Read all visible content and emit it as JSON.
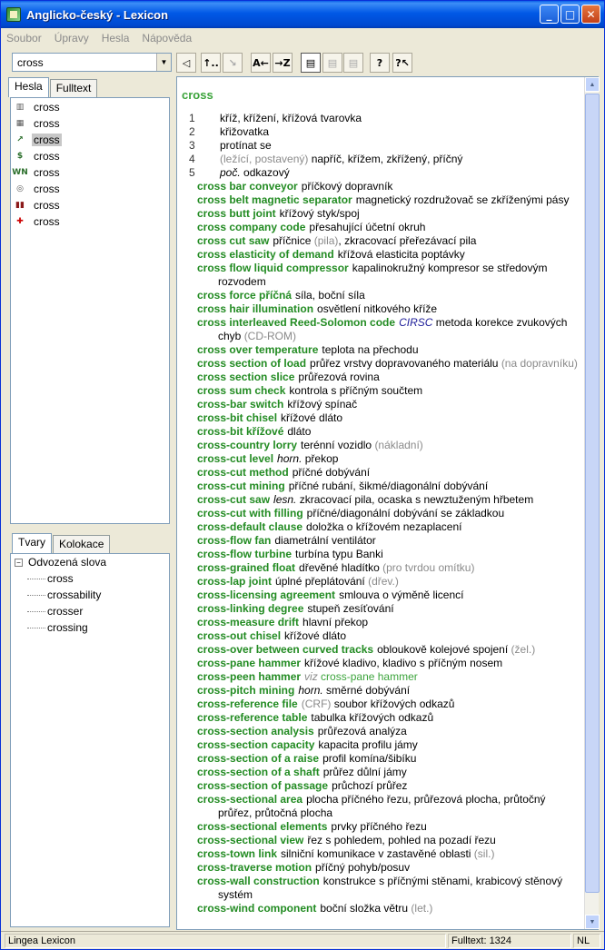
{
  "window": {
    "title": "Anglicko-český - Lexicon"
  },
  "menu": [
    "Soubor",
    "Úpravy",
    "Hesla",
    "Nápověda"
  ],
  "search": {
    "value": "cross"
  },
  "toolbar": {
    "tools": [
      {
        "name": "speaker-tool",
        "glyph": "◁"
      },
      {
        "name": "back-tool",
        "glyph": "↑.."
      },
      {
        "name": "forward-tool",
        "glyph": "↘",
        "disabled": true
      },
      {
        "name": "sort-az-tool",
        "glyph": "A←"
      },
      {
        "name": "sort-za-tool",
        "glyph": "→Z"
      },
      {
        "name": "view-full-tool",
        "glyph": "▤",
        "pressed": true
      },
      {
        "name": "view-medium-tool",
        "glyph": "▤",
        "disabled": true
      },
      {
        "name": "view-short-tool",
        "glyph": "▤",
        "disabled": true
      },
      {
        "name": "help-tool",
        "glyph": "?"
      },
      {
        "name": "context-help-tool",
        "glyph": "?↖"
      }
    ]
  },
  "left_tabs": [
    "Hesla",
    "Fulltext"
  ],
  "headwords": [
    {
      "label": "cross",
      "icon": "building-icon",
      "glyph": "▥",
      "color": "#555555"
    },
    {
      "label": "cross",
      "icon": "factory-icon",
      "glyph": "▦",
      "color": "#555555"
    },
    {
      "label": "cross",
      "icon": "chart-icon",
      "glyph": "↗",
      "color": "#2a6e2a",
      "selected": true
    },
    {
      "label": "cross",
      "icon": "money-icon",
      "glyph": "$",
      "color": "#2a6e2a"
    },
    {
      "label": "cross",
      "icon": "wn-icon",
      "glyph": "WN",
      "color": "#2a6e2a"
    },
    {
      "label": "cross",
      "icon": "handshake-icon",
      "glyph": "◎",
      "color": "#555555"
    },
    {
      "label": "cross",
      "icon": "books-icon",
      "glyph": "▮▮",
      "color": "#8b1a1a"
    },
    {
      "label": "cross",
      "icon": "medical-icon",
      "glyph": "✚",
      "color": "#cc0000"
    }
  ],
  "lower_tabs": [
    "Tvary",
    "Kolokace"
  ],
  "forms": {
    "root": "Odvozená slova",
    "items": [
      "cross",
      "crossability",
      "crosser",
      "crossing"
    ]
  },
  "entry": {
    "headword": "cross",
    "senses": [
      {
        "num": "1",
        "parts": [
          {
            "t": "kříž, křížení, křížová tvarovka"
          }
        ]
      },
      {
        "num": "2",
        "parts": [
          {
            "t": "křižovatka"
          }
        ]
      },
      {
        "num": "3",
        "parts": [
          {
            "t": "protínat se"
          }
        ]
      },
      {
        "num": "4",
        "parts": [
          {
            "t": "(ležící, postavený)",
            "c": "gray"
          },
          {
            "t": " napříč, křížem, zkřížený, příčný"
          }
        ]
      },
      {
        "num": "5",
        "parts": [
          {
            "t": "poč.",
            "c": "ital"
          },
          {
            "t": " odkazový"
          }
        ]
      }
    ],
    "phrases": [
      {
        "term": "cross bar conveyor",
        "parts": [
          {
            "t": "příčkový dopravník"
          }
        ]
      },
      {
        "term": "cross belt magnetic separator",
        "parts": [
          {
            "t": "magnetický rozdružovač se zkříženými pásy"
          }
        ]
      },
      {
        "term": "cross butt joint",
        "parts": [
          {
            "t": "křížový styk/spoj"
          }
        ]
      },
      {
        "term": "cross company code",
        "parts": [
          {
            "t": "přesahující účetní okruh"
          }
        ]
      },
      {
        "term": "cross cut saw",
        "parts": [
          {
            "t": "příčnice "
          },
          {
            "t": "(pila)",
            "c": "note"
          },
          {
            "t": ", zkracovací přeřezávací pila"
          }
        ]
      },
      {
        "term": "cross elasticity of demand",
        "parts": [
          {
            "t": "křížová elasticita poptávky"
          }
        ]
      },
      {
        "term": "cross flow liquid compressor",
        "parts": [
          {
            "t": "kapalinokružný kompresor se středovým rozvodem"
          }
        ]
      },
      {
        "term": "cross force příčná",
        "parts": [
          {
            "t": "síla, boční síla"
          }
        ]
      },
      {
        "term": "cross hair illumination",
        "parts": [
          {
            "t": "osvětlení nitkového kříže"
          }
        ]
      },
      {
        "term": "cross interleaved Reed-Solomon code",
        "parts": [
          {
            "t": "CIRSC",
            "c": "abbr"
          },
          {
            "t": " metoda korekce zvukových chyb "
          },
          {
            "t": "(CD-ROM)",
            "c": "note"
          }
        ]
      },
      {
        "term": "cross over temperature",
        "parts": [
          {
            "t": "teplota na přechodu"
          }
        ]
      },
      {
        "term": "cross section of load",
        "parts": [
          {
            "t": "průřez vrstvy dopravovaného materiálu "
          },
          {
            "t": "(na dopravníku)",
            "c": "note"
          }
        ]
      },
      {
        "term": "cross section slice",
        "parts": [
          {
            "t": "průřezová rovina"
          }
        ]
      },
      {
        "term": "cross sum check",
        "parts": [
          {
            "t": "kontrola s příčným součtem"
          }
        ]
      },
      {
        "term": "cross-bar switch",
        "parts": [
          {
            "t": "křížový spínač"
          }
        ]
      },
      {
        "term": "cross-bit chisel",
        "parts": [
          {
            "t": "křížové dláto"
          }
        ]
      },
      {
        "term": "cross-bit křížové",
        "parts": [
          {
            "t": "dláto"
          }
        ]
      },
      {
        "term": "cross-country lorry",
        "parts": [
          {
            "t": "terénní vozidlo "
          },
          {
            "t": "(nákladní)",
            "c": "note"
          }
        ]
      },
      {
        "term": "cross-cut level",
        "parts": [
          {
            "t": "horn.",
            "c": "qual"
          },
          {
            "t": " překop"
          }
        ]
      },
      {
        "term": "cross-cut method",
        "parts": [
          {
            "t": "příčné dobývání"
          }
        ]
      },
      {
        "term": "cross-cut mining",
        "parts": [
          {
            "t": "příčné rubání, šikmé/diagonální dobývání"
          }
        ]
      },
      {
        "term": "cross-cut saw",
        "parts": [
          {
            "t": "lesn.",
            "c": "qual"
          },
          {
            "t": " zkracovací pila, ocaska s newztuženým hřbetem"
          }
        ]
      },
      {
        "term": "cross-cut with filling",
        "parts": [
          {
            "t": "příčné/diagonální dobývání se základkou"
          }
        ]
      },
      {
        "term": "cross-default clause",
        "parts": [
          {
            "t": "doložka o křížovém nezaplacení"
          }
        ]
      },
      {
        "term": "cross-flow fan",
        "parts": [
          {
            "t": "diametrální ventilátor"
          }
        ]
      },
      {
        "term": "cross-flow turbine",
        "parts": [
          {
            "t": "turbína typu Banki"
          }
        ]
      },
      {
        "term": "cross-grained float",
        "parts": [
          {
            "t": "dřevěné hladítko "
          },
          {
            "t": "(pro tvrdou omítku)",
            "c": "note"
          }
        ]
      },
      {
        "term": "cross-lap joint",
        "parts": [
          {
            "t": "úplné přeplátování "
          },
          {
            "t": "(dřev.)",
            "c": "note"
          }
        ]
      },
      {
        "term": "cross-licensing agreement",
        "parts": [
          {
            "t": "smlouva o výměně licencí"
          }
        ]
      },
      {
        "term": "cross-linking degree",
        "parts": [
          {
            "t": "stupeň zesíťování"
          }
        ]
      },
      {
        "term": "cross-measure drift",
        "parts": [
          {
            "t": "hlavní překop"
          }
        ]
      },
      {
        "term": "cross-out chisel",
        "parts": [
          {
            "t": "křížové dláto"
          }
        ]
      },
      {
        "term": "cross-over between curved tracks",
        "parts": [
          {
            "t": "obloukově kolejové spojení "
          },
          {
            "t": "(žel.)",
            "c": "note"
          }
        ]
      },
      {
        "term": "cross-pane hammer",
        "parts": [
          {
            "t": "křížové kladivo, kladivo s příčným nosem"
          }
        ]
      },
      {
        "term": "cross-peen hammer",
        "parts": [
          {
            "t": "viz",
            "c": "note ital"
          },
          {
            "t": " cross-pane hammer",
            "c": "xref"
          }
        ]
      },
      {
        "term": "cross-pitch mining",
        "parts": [
          {
            "t": "horn.",
            "c": "qual"
          },
          {
            "t": " směrné dobývání"
          }
        ]
      },
      {
        "term": "cross-reference file",
        "parts": [
          {
            "t": "(CRF)",
            "c": "note"
          },
          {
            "t": " soubor křížových odkazů"
          }
        ]
      },
      {
        "term": "cross-reference table",
        "parts": [
          {
            "t": "tabulka křížových odkazů"
          }
        ]
      },
      {
        "term": "cross-section analysis",
        "parts": [
          {
            "t": "průřezová analýza"
          }
        ]
      },
      {
        "term": "cross-section capacity",
        "parts": [
          {
            "t": "kapacita profilu jámy"
          }
        ]
      },
      {
        "term": "cross-section of a raise",
        "parts": [
          {
            "t": "profil komína/šibíku"
          }
        ]
      },
      {
        "term": "cross-section of a shaft",
        "parts": [
          {
            "t": "průřez důlní jámy"
          }
        ]
      },
      {
        "term": "cross-section of passage",
        "parts": [
          {
            "t": "průchozí průřez"
          }
        ]
      },
      {
        "term": "cross-sectional area",
        "parts": [
          {
            "t": "plocha příčného řezu, průřezová plocha, průtočný průřez,  průtočná plocha"
          }
        ]
      },
      {
        "term": "cross-sectional elements",
        "parts": [
          {
            "t": "prvky příčného řezu"
          }
        ]
      },
      {
        "term": "cross-sectional view",
        "parts": [
          {
            "t": "řez s pohledem, pohled na pozadí řezu"
          }
        ]
      },
      {
        "term": "cross-town link",
        "parts": [
          {
            "t": "silniční komunikace v zastavěné oblasti "
          },
          {
            "t": "(sil.)",
            "c": "note"
          }
        ]
      },
      {
        "term": "cross-traverse motion",
        "parts": [
          {
            "t": "příčný pohyb/posuv"
          }
        ]
      },
      {
        "term": "cross-wall construction",
        "parts": [
          {
            "t": "konstrukce s příčnými stěnami, krabicový stěnový systém"
          }
        ]
      },
      {
        "term": "cross-wind component",
        "parts": [
          {
            "t": "boční složka větru "
          },
          {
            "t": "(let.)",
            "c": "note"
          }
        ]
      }
    ]
  },
  "status": {
    "app": "Lingea Lexicon",
    "fulltext": "Fulltext: 1324",
    "mode": "NL"
  }
}
